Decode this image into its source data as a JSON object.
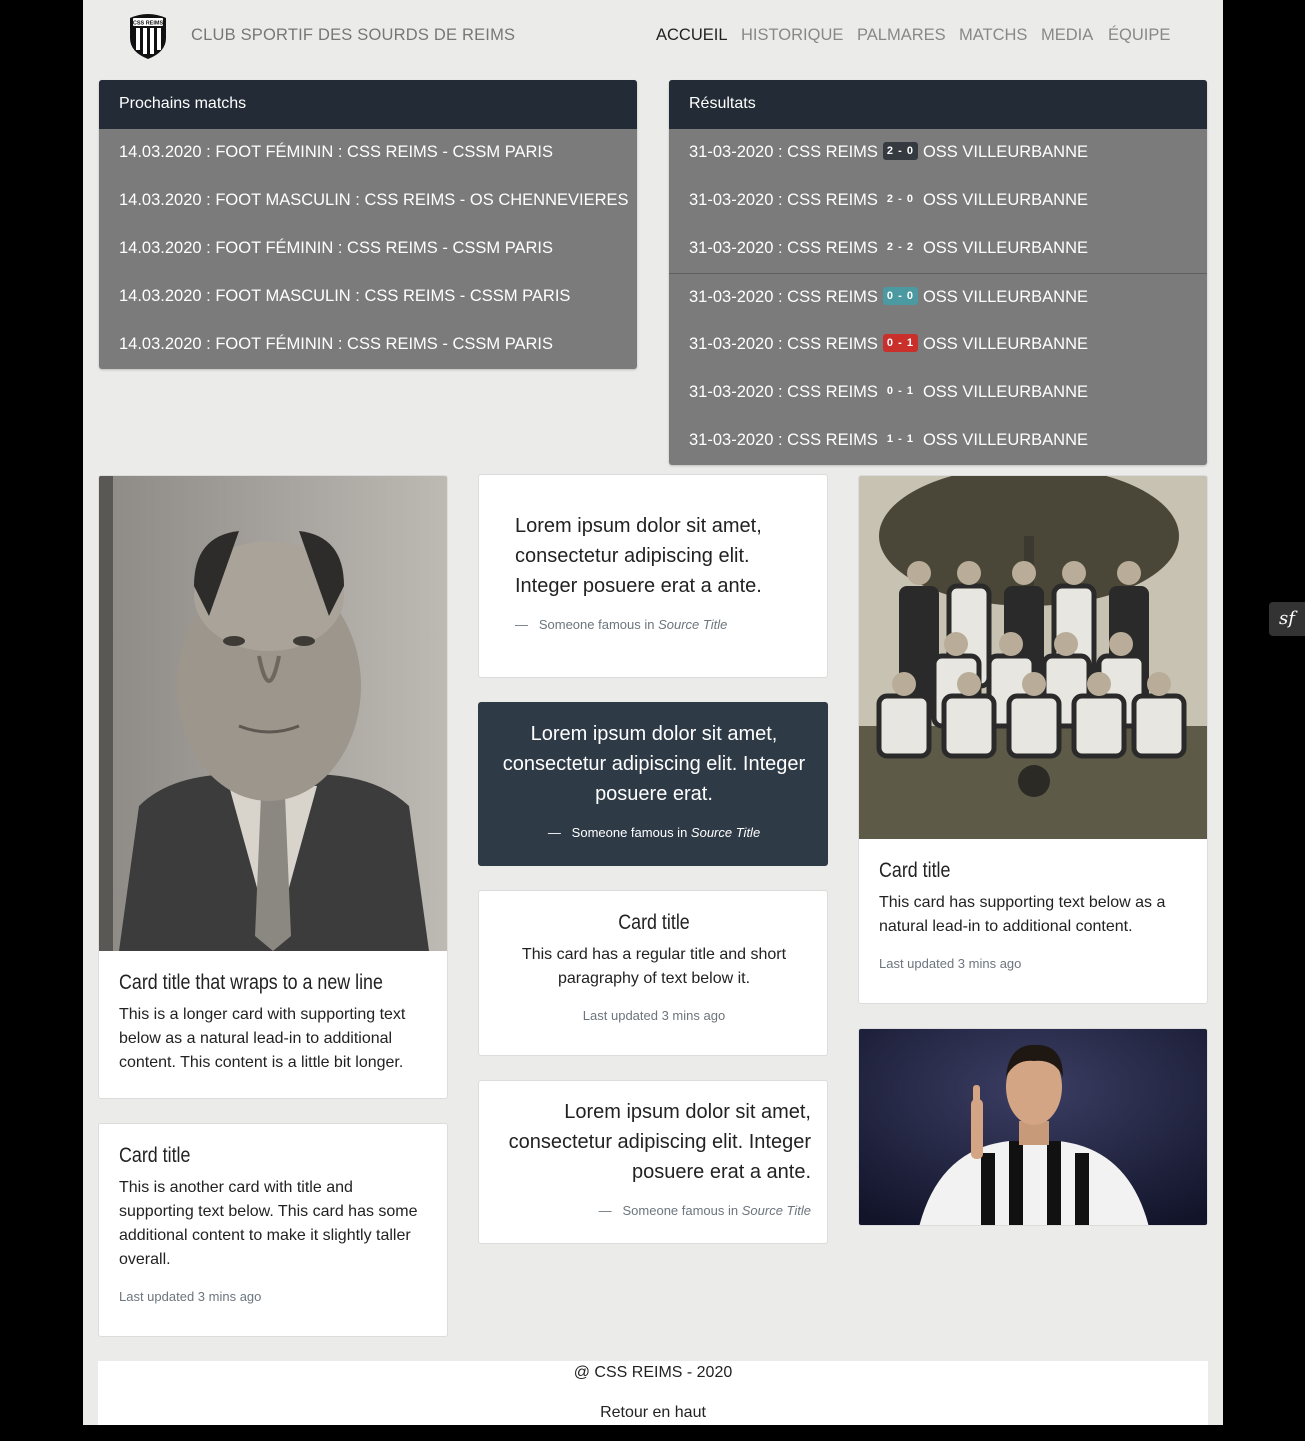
{
  "navbar": {
    "brand": "CLUB SPORTIF DES SOURDS DE REIMS",
    "logo_text": "CSS REIMS",
    "items": [
      "ACCUEIL",
      "HISTORIQUE",
      "PALMARES",
      "MATCHS",
      "MEDIA",
      "ÉQUIPE"
    ],
    "active": "ACCUEIL"
  },
  "upcoming": {
    "title": "Prochains matchs",
    "rows": [
      "14.03.2020 : FOOT FÉMININ : CSS REIMS - CSSM PARIS",
      "14.03.2020 : FOOT MASCULIN : CSS REIMS - OS CHENNEVIERES",
      "14.03.2020 : FOOT FÉMININ : CSS REIMS - CSSM PARIS",
      "14.03.2020 : FOOT MASCULIN : CSS REIMS - CSSM PARIS",
      "14.03.2020 : FOOT FÉMININ : CSS REIMS - CSSM PARIS"
    ]
  },
  "results": {
    "title": "Résultats",
    "rows": [
      {
        "left": "31-03-2020 : CSS REIMS",
        "score": "2 - 0",
        "right": "OSS VILLEURBANNE",
        "badge_color": "#343a40"
      },
      {
        "left": "31-03-2020 : CSS REIMS",
        "score": "2 - 0",
        "right": "OSS VILLEURBANNE",
        "badge_color": "transparent"
      },
      {
        "left": "31-03-2020 : CSS REIMS",
        "score": "2 - 2",
        "right": "OSS VILLEURBANNE",
        "badge_color": "transparent"
      },
      {
        "left": "31-03-2020 : CSS REIMS",
        "score": "0 - 0",
        "right": "OSS VILLEURBANNE",
        "badge_color": "#4b9aa2"
      },
      {
        "left": "31-03-2020 : CSS REIMS",
        "score": "0 - 1",
        "right": "OSS VILLEURBANNE",
        "badge_color": "#c9302c"
      },
      {
        "left": "31-03-2020 : CSS REIMS",
        "score": "0 - 1",
        "right": "OSS VILLEURBANNE",
        "badge_color": "transparent"
      },
      {
        "left": "31-03-2020 : CSS REIMS",
        "score": "1 - 1",
        "right": "OSS VILLEURBANNE",
        "badge_color": "transparent"
      }
    ]
  },
  "cards": {
    "portrait": {
      "title": "Card title that wraps to a new line",
      "text": "This is a longer card with supporting text below as a natural lead-in to additional content. This content is a little bit longer."
    },
    "another": {
      "title": "Card title",
      "text": "This is another card with title and supporting text below. This card has some additional content to make it slightly taller overall.",
      "updated": "Last updated 3 mins ago"
    },
    "quote1": {
      "text": "Lorem ipsum dolor sit amet, consectetur adipiscing elit. Integer posuere erat a ante.",
      "dash": "—",
      "author": "Someone famous in",
      "source": "Source Title"
    },
    "quote2": {
      "text": "Lorem ipsum dolor sit amet, consectetur adipiscing elit. Integer posuere erat.",
      "dash": "—",
      "author": "Someone famous in",
      "source": "Source Title"
    },
    "center": {
      "title": "Card title",
      "text": "This card has a regular title and short paragraphy of text below it.",
      "updated": "Last updated 3 mins ago"
    },
    "quote3": {
      "text": "Lorem ipsum dolor sit amet, consectetur adipiscing elit. Integer posuere erat a ante.",
      "dash": "—",
      "author": "Someone famous in",
      "source": "Source Title"
    },
    "team": {
      "title": "Card title",
      "text": "This card has supporting text below as a natural lead-in to additional content.",
      "updated": "Last updated 3 mins ago"
    }
  },
  "footer": {
    "copyright": "@ CSS REIMS - 2020",
    "back_to_top": "Retour en haut"
  },
  "toolbar_icon": "symfony-icon",
  "toolbar_glyph": "sf"
}
